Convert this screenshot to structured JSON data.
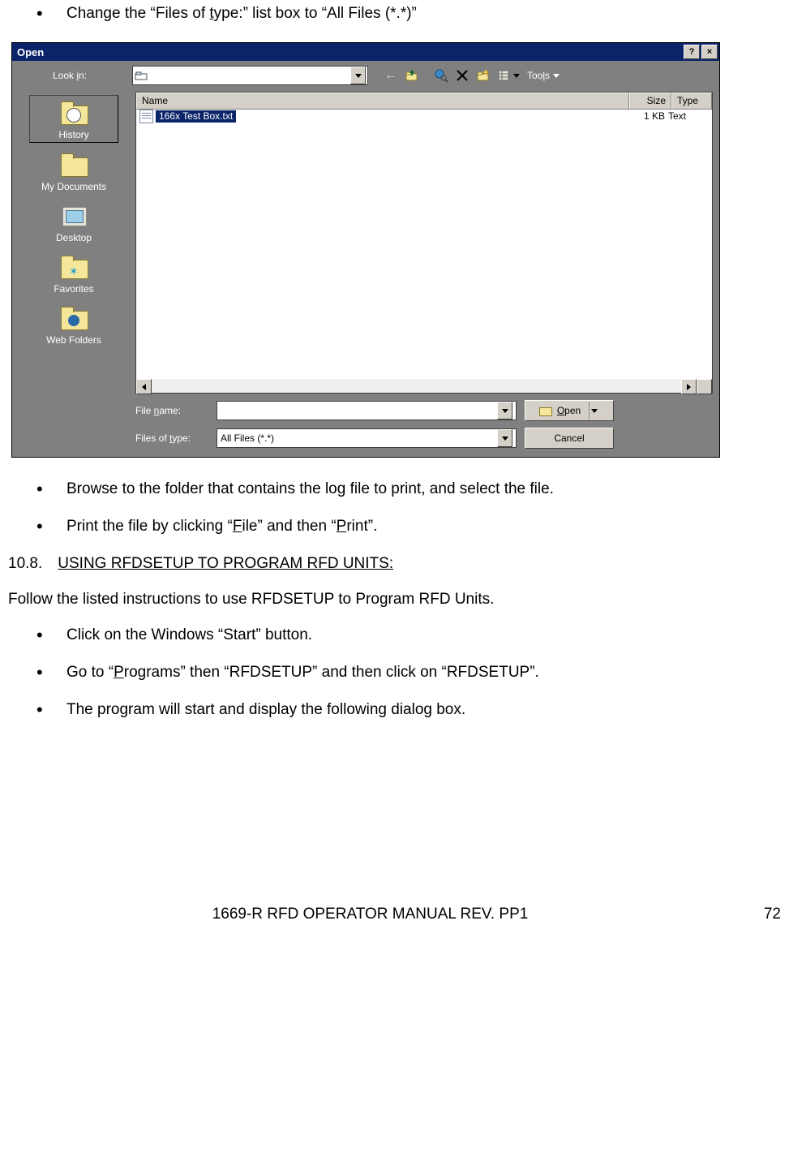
{
  "bullets_top": [
    "Change the “Files of type:” list box to “All Files (*.*)”"
  ],
  "dialog": {
    "title": "Open",
    "help": "?",
    "close": "×",
    "lookin_label": "Look in:",
    "tools_label": "Tools",
    "columns": {
      "name": "Name",
      "size": "Size",
      "type": "Type"
    },
    "files": [
      {
        "name": "166x Test Box.txt",
        "size": "1 KB",
        "type": "Text"
      }
    ],
    "filename_label": "File name:",
    "filename_value": "",
    "filetype_label": "Files of type:",
    "filetype_value": "All Files (*.*)",
    "open_btn": "Open",
    "cancel_btn": "Cancel",
    "places": [
      {
        "key": "history",
        "label": "History"
      },
      {
        "key": "mydocs",
        "label": "My Documents"
      },
      {
        "key": "desktop",
        "label": "Desktop"
      },
      {
        "key": "favorites",
        "label": "Favorites"
      },
      {
        "key": "webfolders",
        "label": "Web Folders"
      }
    ]
  },
  "bullets_mid": [
    "Browse to the folder that contains the log file to print, and select the file.",
    "Print the file by clicking “File” and then “Print”."
  ],
  "section": {
    "num": "10.8.",
    "title": "USING RFDSETUP TO PROGRAM RFD UNITS:"
  },
  "intro": "Follow the listed instructions to use RFDSETUP to Program RFD Units.",
  "bullets_bot": [
    "Click on the Windows “Start” button.",
    "Go to “Programs” then “RFDSETUP” and then click on “RFDSETUP”.",
    "The program will start and display the following dialog box."
  ],
  "footer_text": "1669-R RFD OPERATOR MANUAL REV. PP1",
  "page_number": "72"
}
